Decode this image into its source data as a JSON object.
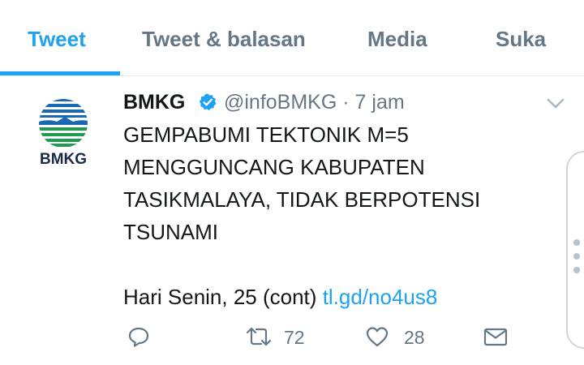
{
  "tabs": [
    {
      "label": "Tweet",
      "active": true
    },
    {
      "label": "Tweet & balasan",
      "active": false
    },
    {
      "label": "Media",
      "active": false
    },
    {
      "label": "Suka",
      "active": false
    }
  ],
  "tweet": {
    "avatar_text": "BMKG",
    "name": "BMKG",
    "verified": true,
    "handle": "@infoBMKG",
    "separator": "·",
    "time": "7 jam",
    "text_lines": [
      "GEMPABUMI TEKTONIK M=5",
      "MENGGUNCANG KABUPATEN",
      "TASIKMALAYA, TIDAK BERPOTENSI",
      "TSUNAMI"
    ],
    "last_line_text": "Hari Senin, 25 (cont)",
    "link_text": "tl.gd/no4us8",
    "actions": {
      "reply_icon": "reply-icon",
      "retweet_icon": "retweet-icon",
      "retweet_count": "72",
      "like_icon": "heart-icon",
      "like_count": "28",
      "dm_icon": "envelope-icon"
    }
  },
  "colors": {
    "accent": "#1da1f2",
    "muted": "#657786",
    "text": "#14171a",
    "bmkg_blue": "#1a67b3",
    "bmkg_green": "#1e9b50"
  }
}
